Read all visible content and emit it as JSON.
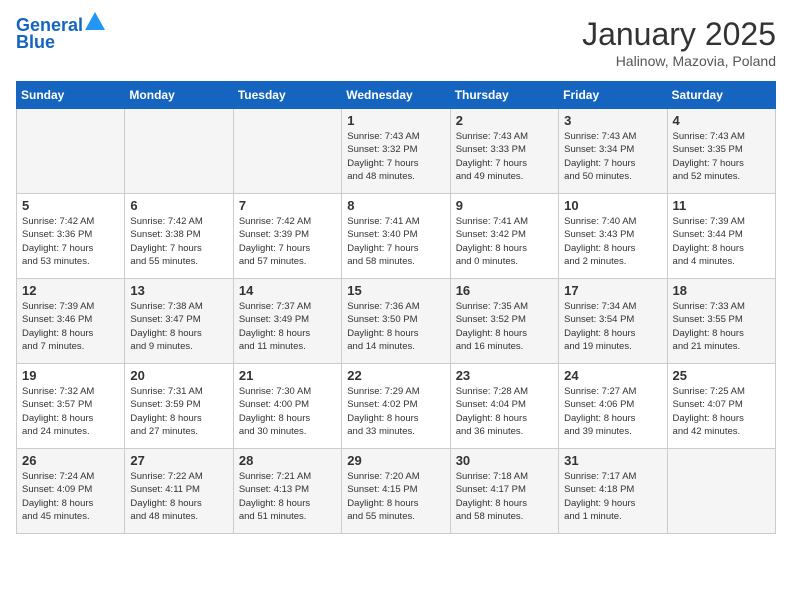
{
  "header": {
    "logo_line1": "General",
    "logo_line2": "Blue",
    "month": "January 2025",
    "location": "Halinow, Mazovia, Poland"
  },
  "days_of_week": [
    "Sunday",
    "Monday",
    "Tuesday",
    "Wednesday",
    "Thursday",
    "Friday",
    "Saturday"
  ],
  "weeks": [
    [
      {
        "day": "",
        "info": ""
      },
      {
        "day": "",
        "info": ""
      },
      {
        "day": "",
        "info": ""
      },
      {
        "day": "1",
        "info": "Sunrise: 7:43 AM\nSunset: 3:32 PM\nDaylight: 7 hours\nand 48 minutes."
      },
      {
        "day": "2",
        "info": "Sunrise: 7:43 AM\nSunset: 3:33 PM\nDaylight: 7 hours\nand 49 minutes."
      },
      {
        "day": "3",
        "info": "Sunrise: 7:43 AM\nSunset: 3:34 PM\nDaylight: 7 hours\nand 50 minutes."
      },
      {
        "day": "4",
        "info": "Sunrise: 7:43 AM\nSunset: 3:35 PM\nDaylight: 7 hours\nand 52 minutes."
      }
    ],
    [
      {
        "day": "5",
        "info": "Sunrise: 7:42 AM\nSunset: 3:36 PM\nDaylight: 7 hours\nand 53 minutes."
      },
      {
        "day": "6",
        "info": "Sunrise: 7:42 AM\nSunset: 3:38 PM\nDaylight: 7 hours\nand 55 minutes."
      },
      {
        "day": "7",
        "info": "Sunrise: 7:42 AM\nSunset: 3:39 PM\nDaylight: 7 hours\nand 57 minutes."
      },
      {
        "day": "8",
        "info": "Sunrise: 7:41 AM\nSunset: 3:40 PM\nDaylight: 7 hours\nand 58 minutes."
      },
      {
        "day": "9",
        "info": "Sunrise: 7:41 AM\nSunset: 3:42 PM\nDaylight: 8 hours\nand 0 minutes."
      },
      {
        "day": "10",
        "info": "Sunrise: 7:40 AM\nSunset: 3:43 PM\nDaylight: 8 hours\nand 2 minutes."
      },
      {
        "day": "11",
        "info": "Sunrise: 7:39 AM\nSunset: 3:44 PM\nDaylight: 8 hours\nand 4 minutes."
      }
    ],
    [
      {
        "day": "12",
        "info": "Sunrise: 7:39 AM\nSunset: 3:46 PM\nDaylight: 8 hours\nand 7 minutes."
      },
      {
        "day": "13",
        "info": "Sunrise: 7:38 AM\nSunset: 3:47 PM\nDaylight: 8 hours\nand 9 minutes."
      },
      {
        "day": "14",
        "info": "Sunrise: 7:37 AM\nSunset: 3:49 PM\nDaylight: 8 hours\nand 11 minutes."
      },
      {
        "day": "15",
        "info": "Sunrise: 7:36 AM\nSunset: 3:50 PM\nDaylight: 8 hours\nand 14 minutes."
      },
      {
        "day": "16",
        "info": "Sunrise: 7:35 AM\nSunset: 3:52 PM\nDaylight: 8 hours\nand 16 minutes."
      },
      {
        "day": "17",
        "info": "Sunrise: 7:34 AM\nSunset: 3:54 PM\nDaylight: 8 hours\nand 19 minutes."
      },
      {
        "day": "18",
        "info": "Sunrise: 7:33 AM\nSunset: 3:55 PM\nDaylight: 8 hours\nand 21 minutes."
      }
    ],
    [
      {
        "day": "19",
        "info": "Sunrise: 7:32 AM\nSunset: 3:57 PM\nDaylight: 8 hours\nand 24 minutes."
      },
      {
        "day": "20",
        "info": "Sunrise: 7:31 AM\nSunset: 3:59 PM\nDaylight: 8 hours\nand 27 minutes."
      },
      {
        "day": "21",
        "info": "Sunrise: 7:30 AM\nSunset: 4:00 PM\nDaylight: 8 hours\nand 30 minutes."
      },
      {
        "day": "22",
        "info": "Sunrise: 7:29 AM\nSunset: 4:02 PM\nDaylight: 8 hours\nand 33 minutes."
      },
      {
        "day": "23",
        "info": "Sunrise: 7:28 AM\nSunset: 4:04 PM\nDaylight: 8 hours\nand 36 minutes."
      },
      {
        "day": "24",
        "info": "Sunrise: 7:27 AM\nSunset: 4:06 PM\nDaylight: 8 hours\nand 39 minutes."
      },
      {
        "day": "25",
        "info": "Sunrise: 7:25 AM\nSunset: 4:07 PM\nDaylight: 8 hours\nand 42 minutes."
      }
    ],
    [
      {
        "day": "26",
        "info": "Sunrise: 7:24 AM\nSunset: 4:09 PM\nDaylight: 8 hours\nand 45 minutes."
      },
      {
        "day": "27",
        "info": "Sunrise: 7:22 AM\nSunset: 4:11 PM\nDaylight: 8 hours\nand 48 minutes."
      },
      {
        "day": "28",
        "info": "Sunrise: 7:21 AM\nSunset: 4:13 PM\nDaylight: 8 hours\nand 51 minutes."
      },
      {
        "day": "29",
        "info": "Sunrise: 7:20 AM\nSunset: 4:15 PM\nDaylight: 8 hours\nand 55 minutes."
      },
      {
        "day": "30",
        "info": "Sunrise: 7:18 AM\nSunset: 4:17 PM\nDaylight: 8 hours\nand 58 minutes."
      },
      {
        "day": "31",
        "info": "Sunrise: 7:17 AM\nSunset: 4:18 PM\nDaylight: 9 hours\nand 1 minute."
      },
      {
        "day": "",
        "info": ""
      }
    ]
  ]
}
